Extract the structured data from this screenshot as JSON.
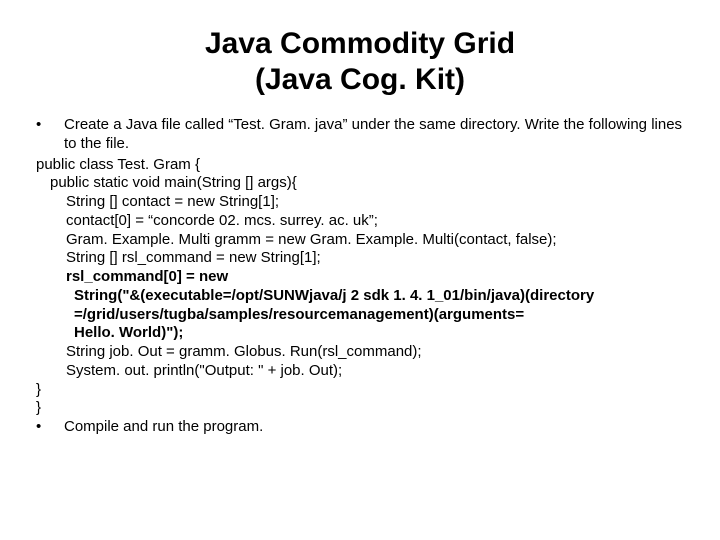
{
  "title": {
    "line1": "Java Commodity Grid",
    "line2": "(Java Cog. Kit)"
  },
  "bullets": {
    "create": "Create a Java file called “Test. Gram. java” under the same directory. Write the following lines to the file.",
    "compile": "Compile and run the program."
  },
  "code": {
    "l1": "public class Test. Gram {",
    "l2": "public static void main(String [] args){",
    "l3": "String [] contact = new String[1];",
    "l4": "contact[0] = “concorde 02. mcs. surrey. ac. uk”;",
    "l5": "Gram. Example. Multi gramm = new Gram. Example. Multi(contact, false);",
    "l6": "String [] rsl_command = new String[1];",
    "l7a": "rsl_command[0] = new",
    "l7b": "String(\"&(executable=/opt/SUNWjava/j 2 sdk 1. 4. 1_01/bin/java)(directory",
    "l7c": "=/grid/users/tugba/samples/resourcemanagement)(arguments=",
    "l7d": "Hello. World)\");",
    "l8": "String job. Out = gramm. Globus. Run(rsl_command);",
    "l9": "System. out. println(\"Output: \" + job. Out);",
    "l10": "}",
    "l11": "}"
  }
}
